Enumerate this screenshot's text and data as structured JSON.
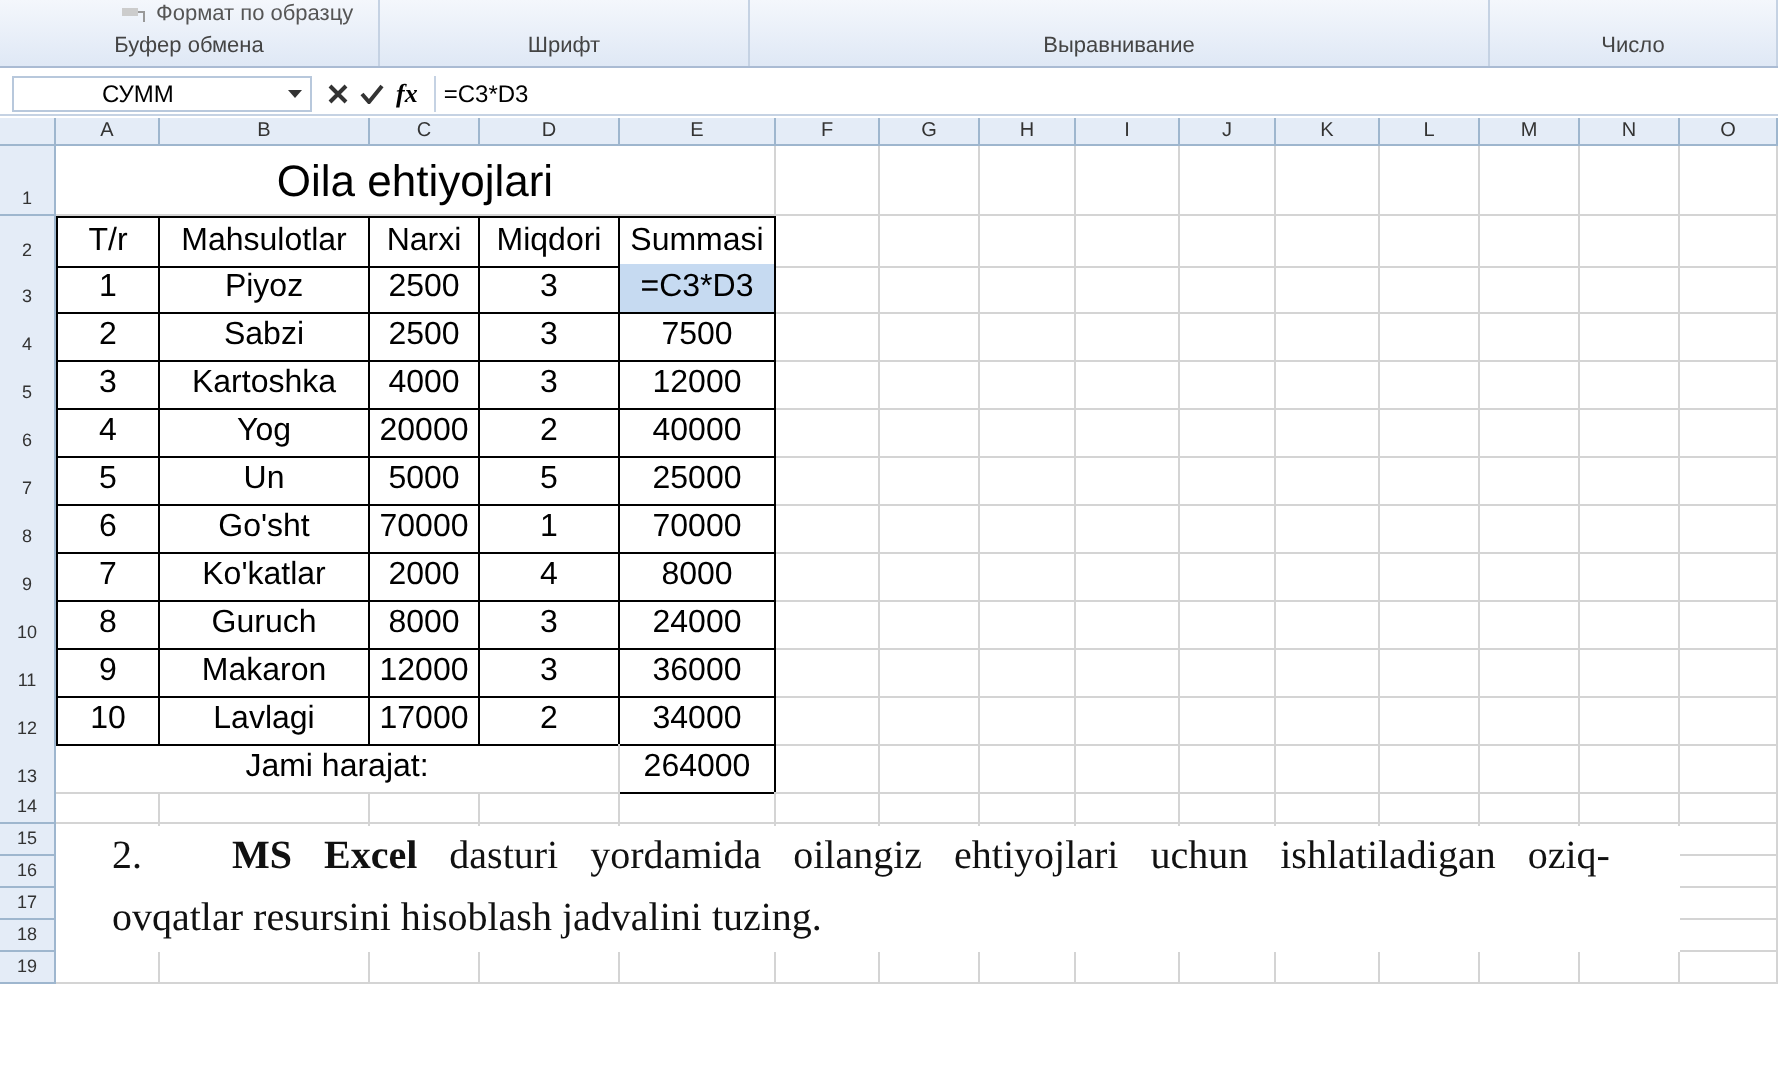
{
  "ribbon": {
    "format_painter": "Формат по образцу",
    "groups": [
      "Буфер обмена",
      "Шрифт",
      "Выравнивание",
      "Число"
    ]
  },
  "formula_bar": {
    "name_box": "СУММ",
    "function_label": "fx",
    "formula": "=C3*D3"
  },
  "column_headers": [
    "A",
    "B",
    "C",
    "D",
    "E",
    "F",
    "G",
    "H",
    "I",
    "J",
    "K",
    "L",
    "M",
    "N",
    "O"
  ],
  "row_numbers": [
    "1",
    "2",
    "3",
    "4",
    "5",
    "6",
    "7",
    "8",
    "9",
    "10",
    "11",
    "12",
    "13",
    "14",
    "15",
    "16",
    "17",
    "18",
    "19"
  ],
  "table": {
    "title": "Oila ehtiyojlari",
    "columns": [
      "T/r",
      "Mahsulotlar",
      "Narxi",
      "Miqdori",
      "Summasi"
    ],
    "rows": [
      {
        "cells": [
          "1",
          "Piyoz",
          "2500",
          "3",
          "=C3*D3"
        ],
        "sum_selected": true
      },
      {
        "cells": [
          "2",
          "Sabzi",
          "2500",
          "3",
          "7500"
        ],
        "sum_selected": false
      },
      {
        "cells": [
          "3",
          "Kartoshka",
          "4000",
          "3",
          "12000"
        ],
        "sum_selected": false
      },
      {
        "cells": [
          "4",
          "Yog",
          "20000",
          "2",
          "40000"
        ],
        "sum_selected": false
      },
      {
        "cells": [
          "5",
          "Un",
          "5000",
          "5",
          "25000"
        ],
        "sum_selected": false
      },
      {
        "cells": [
          "6",
          "Go'sht",
          "70000",
          "1",
          "70000"
        ],
        "sum_selected": false
      },
      {
        "cells": [
          "7",
          "Ko'katlar",
          "2000",
          "4",
          "8000"
        ],
        "sum_selected": false
      },
      {
        "cells": [
          "8",
          "Guruch",
          "8000",
          "3",
          "24000"
        ],
        "sum_selected": false
      },
      {
        "cells": [
          "9",
          "Makaron",
          "12000",
          "3",
          "36000"
        ],
        "sum_selected": false
      },
      {
        "cells": [
          "10",
          "Lavlagi",
          "17000",
          "2",
          "34000"
        ],
        "sum_selected": false
      }
    ],
    "total_label": "Jami harajat:",
    "total_value": "264000"
  },
  "task": {
    "number": "2.",
    "lines": [
      "**MS Excel** dasturi yordamida oilangiz ehtiyojlari uchun ishlatiladigan oziq-",
      "ovqatlar resursini hisoblash jadvalini tuzing."
    ]
  }
}
